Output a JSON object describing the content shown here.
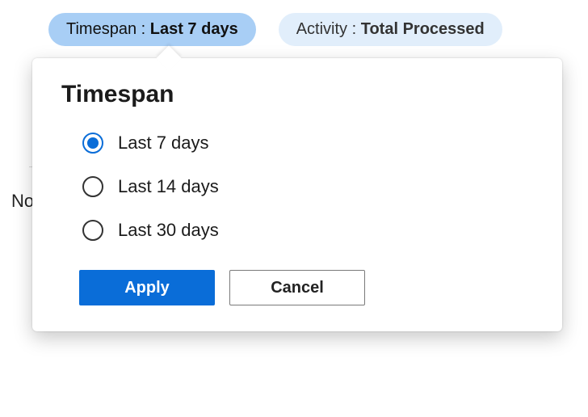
{
  "filters": {
    "timespan": {
      "label": "Timespan",
      "sep": " : ",
      "value": "Last 7 days"
    },
    "activity": {
      "label": "Activity",
      "sep": " : ",
      "value": "Total Processed"
    }
  },
  "background": {
    "clipped_text": "No"
  },
  "popover": {
    "title": "Timespan",
    "options": [
      {
        "label": "Last 7 days",
        "selected": true
      },
      {
        "label": "Last 14 days",
        "selected": false
      },
      {
        "label": "Last 30 days",
        "selected": false
      }
    ],
    "buttons": {
      "apply": "Apply",
      "cancel": "Cancel"
    }
  }
}
